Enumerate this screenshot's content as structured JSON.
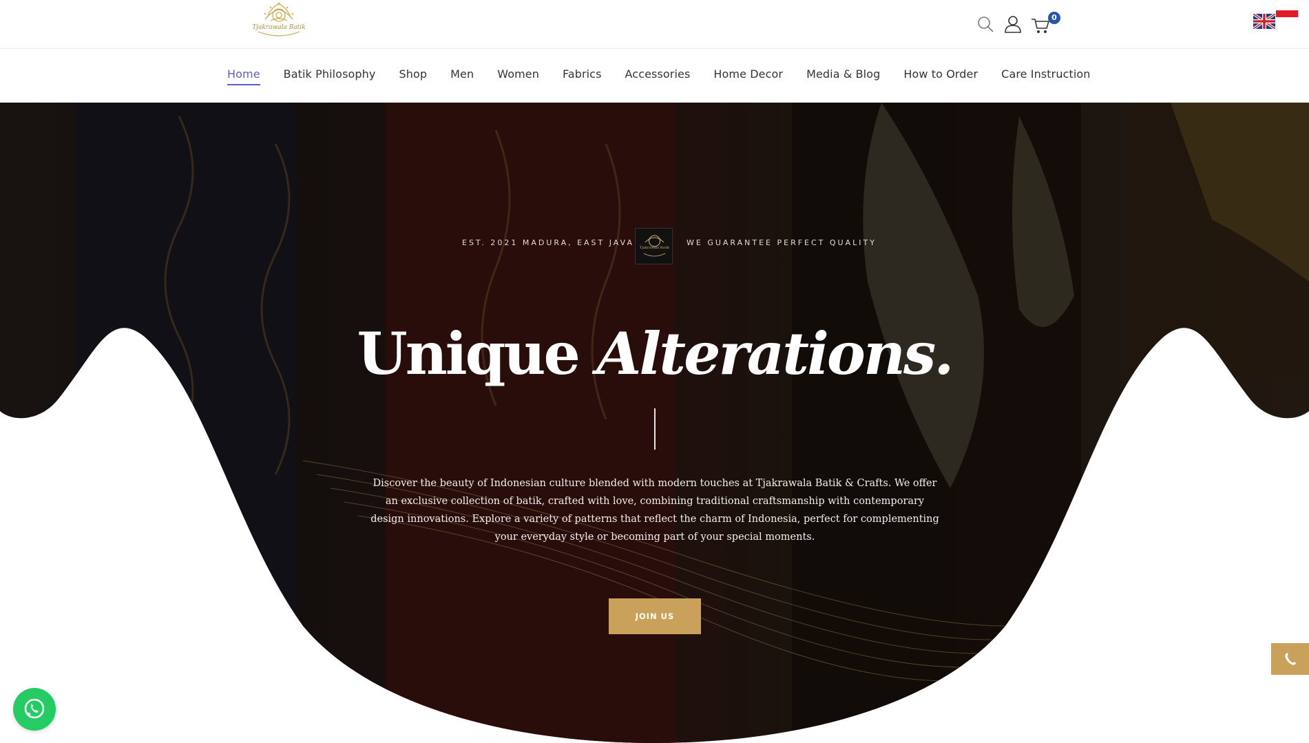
{
  "header": {
    "logo": {
      "text": "Tjakrawala Batik",
      "icon": "brand-logo-icon"
    },
    "icons": {
      "search": "search-icon",
      "account": "user-icon",
      "cart": "cart-icon"
    },
    "cart_count": "0",
    "languages": [
      "english-flag-icon",
      "indonesia-flag-icon"
    ]
  },
  "nav": {
    "items": [
      {
        "label": "Home",
        "active": true
      },
      {
        "label": "Batik Philosophy"
      },
      {
        "label": "Shop"
      },
      {
        "label": "Men"
      },
      {
        "label": "Women"
      },
      {
        "label": "Fabrics"
      },
      {
        "label": "Accessories"
      },
      {
        "label": "Home Decor"
      },
      {
        "label": "Media & Blog"
      },
      {
        "label": "How to Order"
      },
      {
        "label": "Care Instruction"
      }
    ],
    "active_color": "#5b5fc7"
  },
  "hero": {
    "tagline_left": "EST. 2021 MADURA, EAST JAVA",
    "tagline_right": "WE GUARANTEE PERFECT QUALITY",
    "badge_text": "Tjakrawala Batik",
    "title_regular": "Unique",
    "title_italic": "Alterations.",
    "description": "Discover the beauty of Indonesian culture blended with modern touches at Tjakrawala Batik & Crafts. We offer an exclusive collection of batik, crafted with love, combining traditional craftsmanship with contemporary design innovations. Explore a variety of patterns that reflect the charm of Indonesia, perfect for complementing your everyday style or becoming part of your special moments.",
    "cta_label": "JOIN US",
    "accent_color": "#c9a15a"
  },
  "floating": {
    "call_icon": "phone-icon",
    "whatsapp_icon": "whatsapp-icon"
  }
}
